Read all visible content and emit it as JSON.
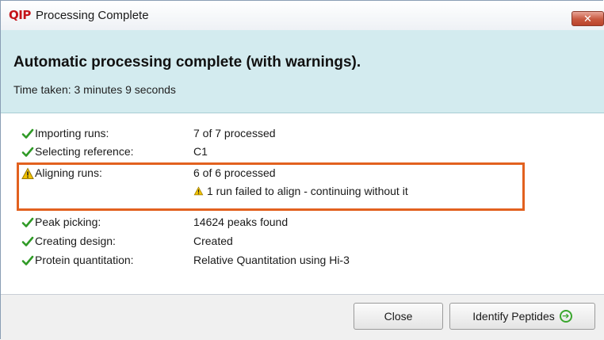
{
  "window": {
    "logo_text": "QIP",
    "title": "Processing Complete",
    "close_label": "✕"
  },
  "header": {
    "heading": "Automatic processing complete (with warnings).",
    "time_taken": "Time taken: 3 minutes 9 seconds"
  },
  "steps": [
    {
      "status": "ok",
      "label": "Importing runs:",
      "value": "7 of 7 processed"
    },
    {
      "status": "ok",
      "label": "Selecting reference:",
      "value": "C1"
    },
    {
      "status": "warning",
      "label": "Aligning runs:",
      "value": "6 of 6 processed",
      "warning": "1 run failed to align - continuing without it"
    },
    {
      "status": "ok",
      "label": "Peak picking:",
      "value": "14624 peaks found"
    },
    {
      "status": "ok",
      "label": "Creating design:",
      "value": "Created"
    },
    {
      "status": "ok",
      "label": "Protein quantitation:",
      "value": "Relative Quantitation using Hi-3"
    }
  ],
  "buttons": {
    "close": "Close",
    "identify": "Identify Peptides"
  },
  "colors": {
    "ok": "#2f9a26",
    "warning": "#e0b400",
    "highlight": "#e2611f"
  }
}
